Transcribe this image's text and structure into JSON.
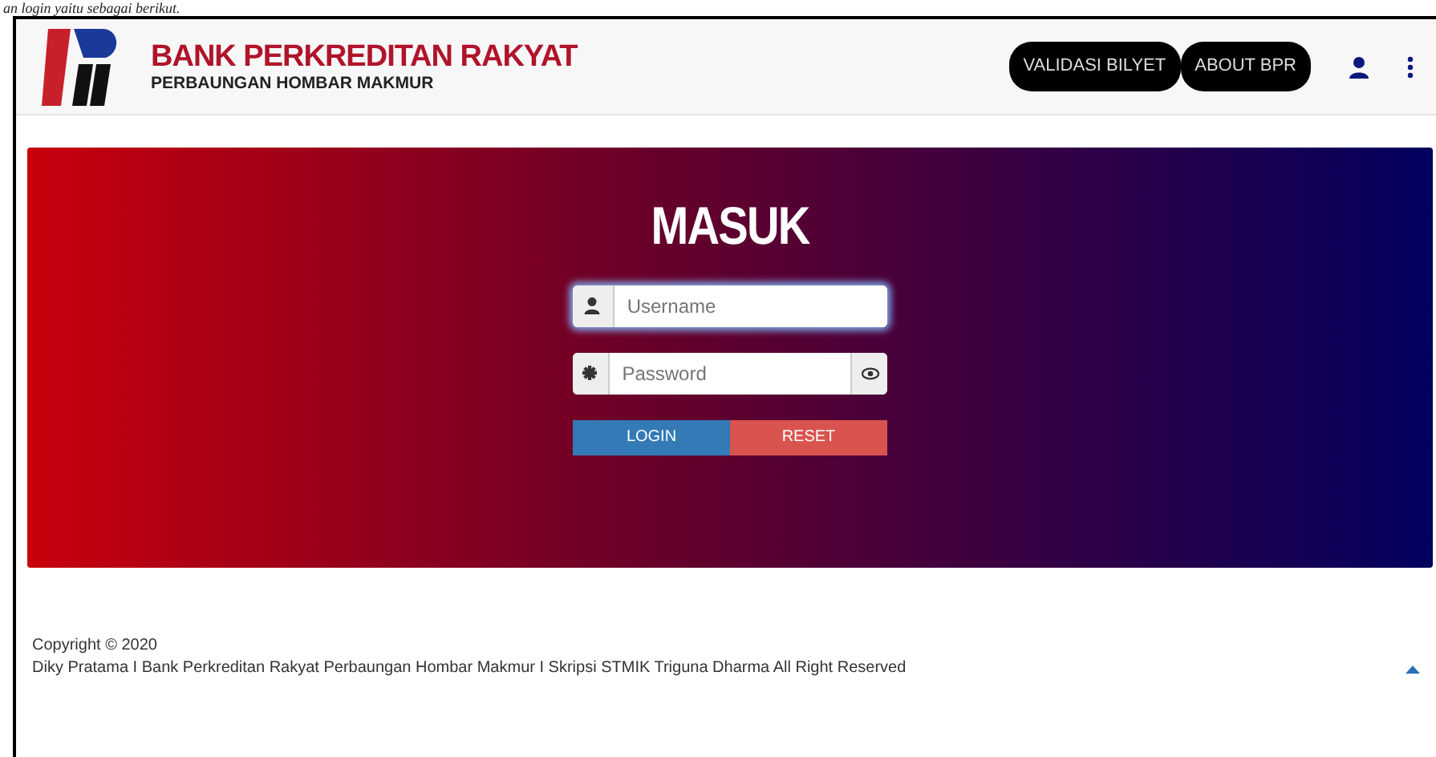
{
  "document_text": "an login yaitu sebagai berikut.",
  "brand": {
    "title": "BANK PERKREDITAN RAKYAT",
    "subtitle": "PERBAUNGAN HOMBAR MAKMUR"
  },
  "nav_buttons": [
    "VALIDASI BILYET",
    "ABOUT BPR"
  ],
  "login": {
    "heading": "MASUK",
    "username": {
      "placeholder": "Username",
      "focused": true
    },
    "password": {
      "placeholder": "Password"
    },
    "buttons": [
      {
        "label": "LOGIN",
        "kind": "primary"
      },
      {
        "label": "RESET",
        "kind": "danger"
      }
    ]
  },
  "footer": {
    "copyright": "Copyright © 2020",
    "credits": "Diky Pratama I Bank Perkreditan Rakyat Perbaungan Hombar Makmur I Skripsi STMIK Triguna Dharma All Right Reserved"
  }
}
